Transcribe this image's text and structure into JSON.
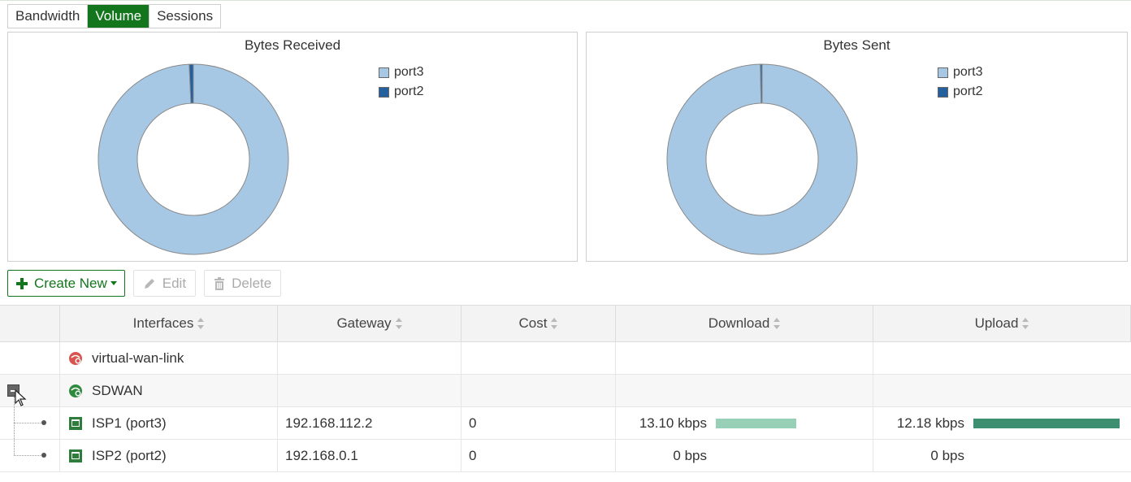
{
  "tabs": [
    {
      "label": "Bandwidth",
      "active": false
    },
    {
      "label": "Volume",
      "active": true
    },
    {
      "label": "Sessions",
      "active": false
    }
  ],
  "charts": {
    "received": {
      "title": "Bytes Received"
    },
    "sent": {
      "title": "Bytes Sent"
    }
  },
  "chart_data": [
    {
      "type": "pie",
      "title": "Bytes Received",
      "categories": [
        "port3",
        "port2"
      ],
      "values": [
        99.3,
        0.7
      ],
      "colors": [
        "#a6c8e4",
        "#24609e"
      ],
      "legend": "right"
    },
    {
      "type": "pie",
      "title": "Bytes Sent",
      "categories": [
        "port3",
        "port2"
      ],
      "values": [
        99.7,
        0.3
      ],
      "colors": [
        "#a6c8e4",
        "#24609e"
      ],
      "legend": "right"
    }
  ],
  "toolbar": {
    "create_label": "Create New",
    "edit_label": "Edit",
    "delete_label": "Delete"
  },
  "table": {
    "columns": [
      "Interfaces",
      "Gateway",
      "Cost",
      "Download",
      "Upload"
    ],
    "rows": [
      {
        "interface": "virtual-wan-link",
        "gateway": "",
        "cost": "",
        "download": "",
        "upload": ""
      },
      {
        "interface": "SDWAN",
        "gateway": "",
        "cost": "",
        "download": "",
        "upload": ""
      },
      {
        "interface": "ISP1 (port3)",
        "gateway": "192.168.112.2",
        "cost": "0",
        "download": "13.10 kbps",
        "download_level": 0.55,
        "upload": "12.18 kbps",
        "upload_level": 1.0
      },
      {
        "interface": "ISP2 (port2)",
        "gateway": "192.168.0.1",
        "cost": "0",
        "download": "0 bps",
        "upload": "0 bps"
      }
    ]
  },
  "colors": {
    "accent_green": "#13761c",
    "download_bar": "#98cfb7",
    "upload_bar": "#3e8f6f"
  }
}
